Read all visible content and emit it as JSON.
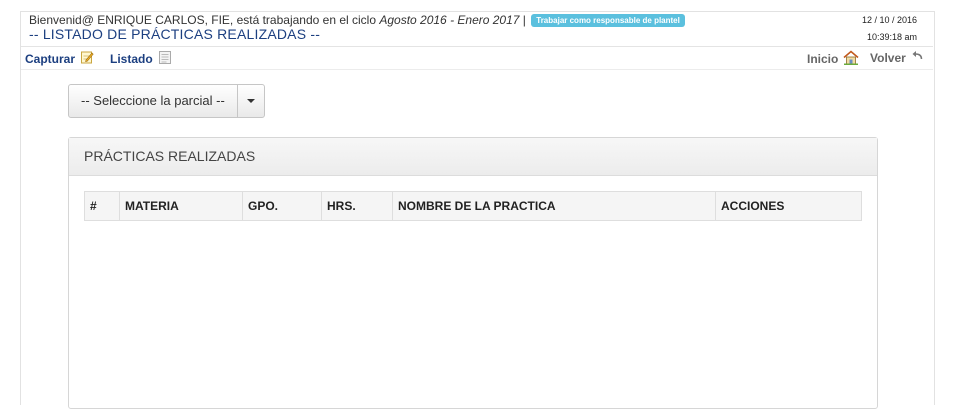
{
  "header": {
    "welcome_prefix": "Bienvenid@ ENRIQUE CARLOS, FIE, está trabajando en el ciclo ",
    "cycle": "Agosto 2016 - Enero 2017",
    "separator": " |",
    "badge": "Trabajar como responsable de plantel",
    "title": "-- LISTADO DE PRÁCTICAS REALIZADAS --",
    "date": "12 / 10 / 2016",
    "time": "10:39:18 am"
  },
  "nav": {
    "capturar": "Capturar",
    "listado": "Listado",
    "inicio": "Inicio",
    "volver": "Volver"
  },
  "filter": {
    "selected": "-- Seleccione la parcial --"
  },
  "panel": {
    "title": "PRÁCTICAS REALIZADAS",
    "columns": [
      "#",
      "MATERIA",
      "GPO.",
      "HRS.",
      "NOMBRE DE LA PRACTICA",
      "ACCIONES"
    ],
    "rows": []
  },
  "colors": {
    "title_blue": "#1c3f80",
    "badge": "#5bc0de"
  },
  "icons": [
    "edit-icon",
    "list-icon",
    "home-icon",
    "back-arrow-icon",
    "caret-down-icon"
  ]
}
